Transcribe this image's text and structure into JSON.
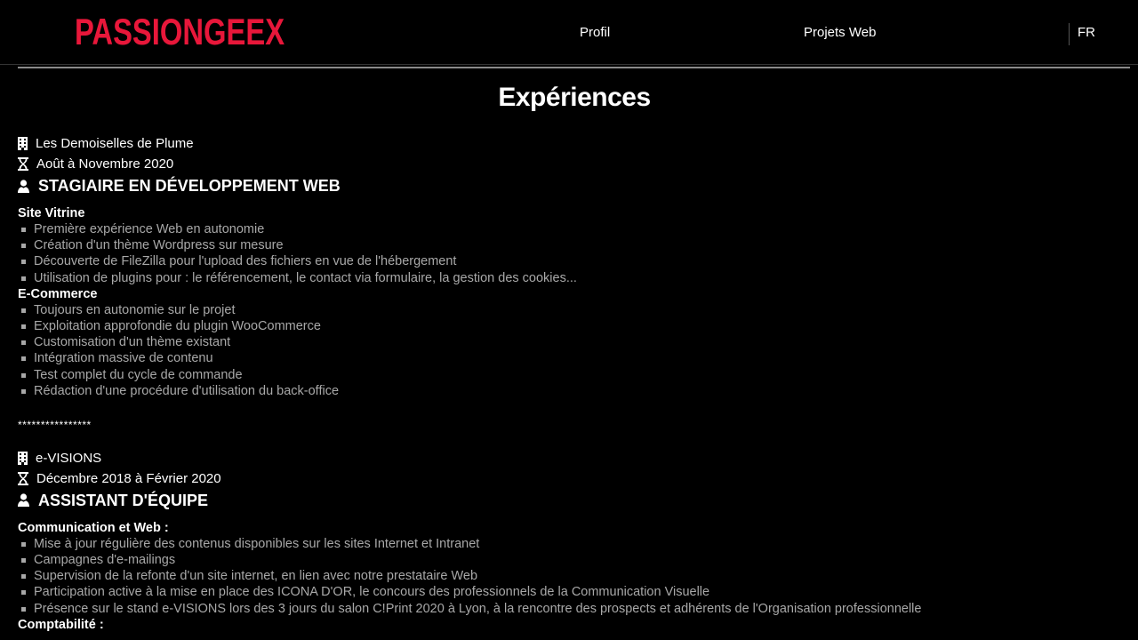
{
  "header": {
    "logo": "PASSIONGEEX",
    "nav": {
      "profil": "Profil",
      "projets": "Projets Web",
      "lang": "FR"
    },
    "colors": {
      "logo": "#e8173a",
      "background": "#000000"
    }
  },
  "page": {
    "title": "Expériences"
  },
  "experiences": [
    {
      "company": "Les Demoiselles de Plume",
      "dates": "Août à Novembre 2020",
      "role": "STAGIAIRE EN DÉVELOPPEMENT WEB",
      "sections": [
        {
          "heading": "Site Vitrine",
          "items": [
            "Première expérience Web en autonomie",
            "Création d'un thème Wordpress sur mesure",
            "Découverte de FileZilla pour l'upload des fichiers en vue de l'hébergement",
            "Utilisation de plugins pour : le référencement, le contact via formulaire, la gestion des cookies..."
          ]
        },
        {
          "heading": "E-Commerce",
          "items": [
            "Toujours en autonomie sur le projet",
            "Exploitation approfondie du plugin WooCommerce",
            "Customisation d'un thème existant",
            "Intégration massive de contenu",
            "Test complet du cycle de commande",
            "Rédaction d'une procédure d'utilisation du back-office"
          ]
        }
      ]
    },
    {
      "company": "e-VISIONS",
      "dates": "Décembre 2018 à Février 2020",
      "role": "ASSISTANT D'ÉQUIPE",
      "sections": [
        {
          "heading": "Communication et Web :",
          "items": [
            "Mise à jour régulière des contenus disponibles sur les sites Internet et Intranet",
            "Campagnes d'e-mailings",
            "Supervision de la refonte d'un site internet, en lien avec notre prestataire Web",
            "Participation active à la mise en place des ICONA D'OR, le concours des professionnels de la Communication Visuelle",
            "Présence sur le stand e-VISIONS lors des 3 jours du salon C!Print 2020 à Lyon, à la rencontre des prospects et adhérents de l'Organisation professionnelle"
          ]
        },
        {
          "heading": "Comptabilité :",
          "items": []
        }
      ]
    }
  ],
  "separator": "****************",
  "icons": {
    "company": "building-icon",
    "dates": "hourglass-icon",
    "role": "user-icon"
  }
}
